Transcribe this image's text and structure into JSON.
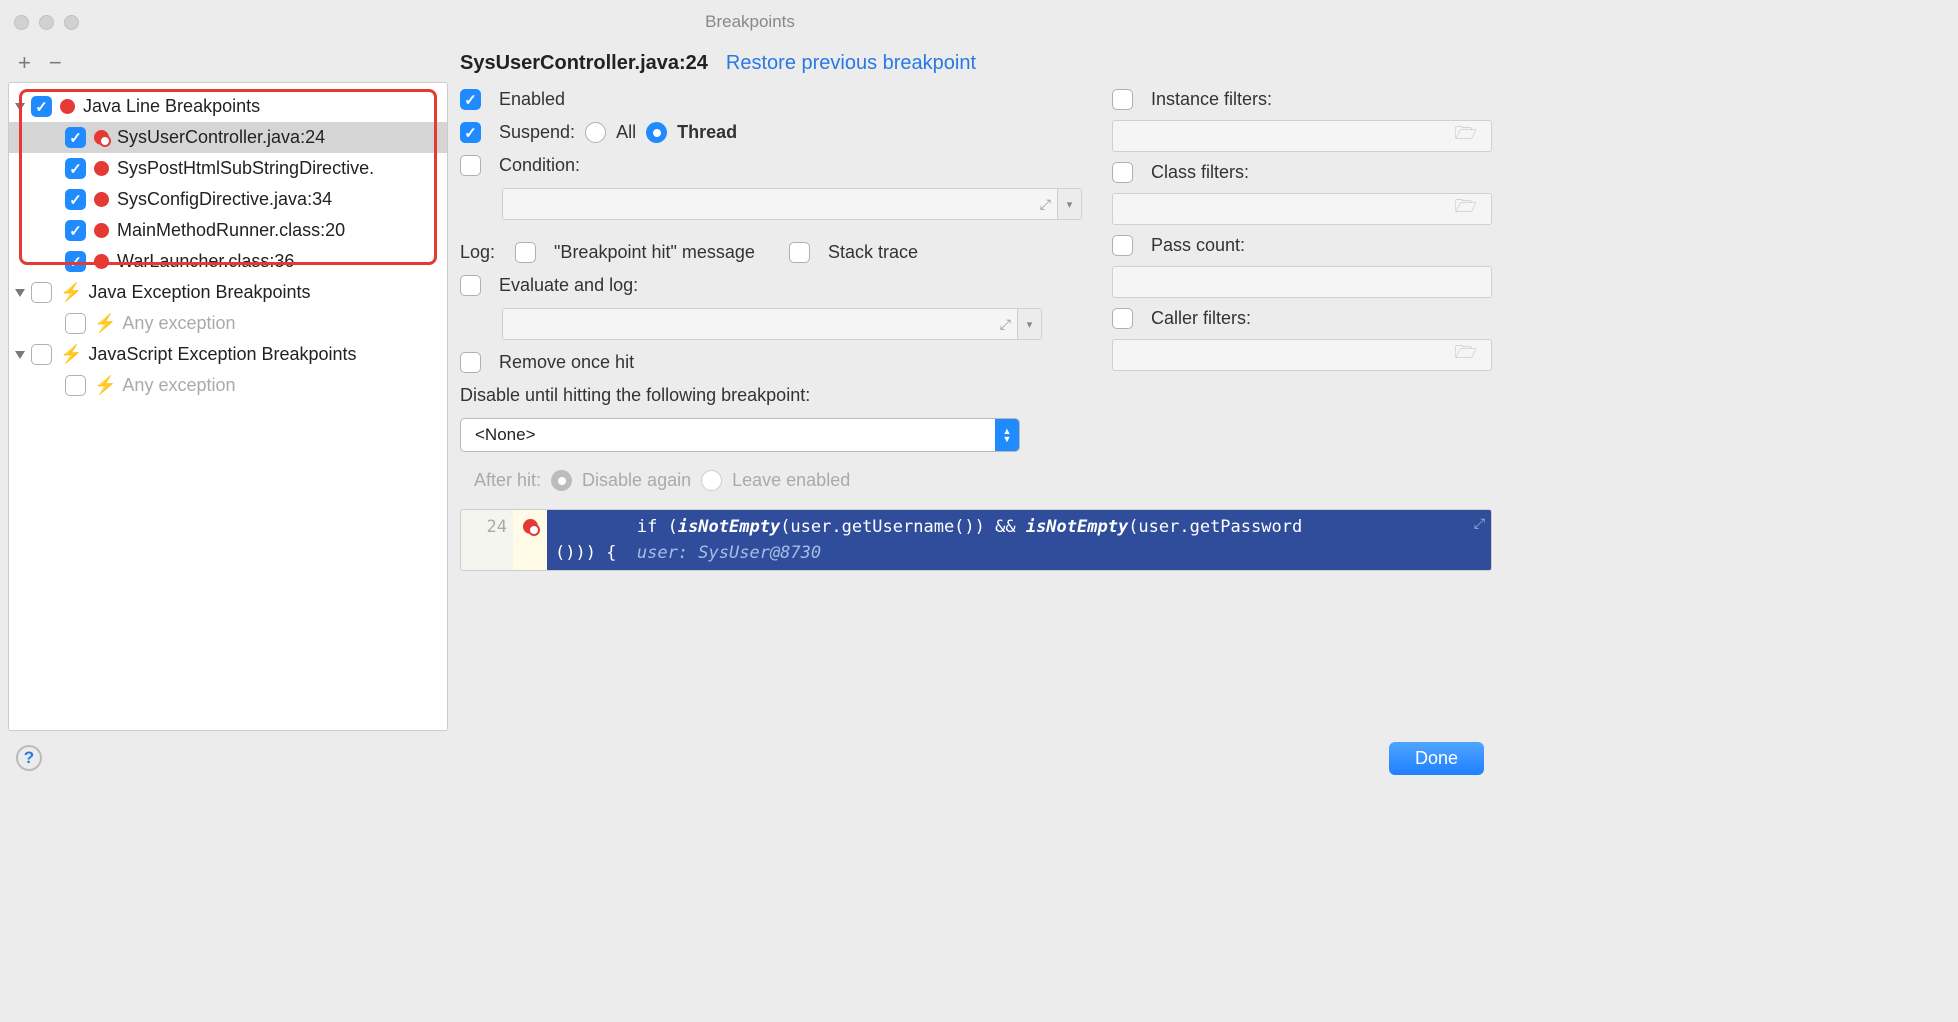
{
  "window": {
    "title": "Breakpoints"
  },
  "toolbar": {
    "add": "+",
    "remove": "−"
  },
  "tree": {
    "groups": [
      {
        "checked": true,
        "icon": "bp-dot",
        "label": "Java Line Breakpoints",
        "items": [
          {
            "checked": true,
            "label": "SysUserController.java:24",
            "selected": true,
            "muted": true
          },
          {
            "checked": true,
            "label": "SysPostHtmlSubStringDirective.",
            "muted": false
          },
          {
            "checked": true,
            "label": "SysConfigDirective.java:34",
            "muted": false
          },
          {
            "checked": true,
            "label": "MainMethodRunner.class:20",
            "muted": false
          },
          {
            "checked": true,
            "label": "WarLauncher.class:36",
            "muted": false
          }
        ]
      },
      {
        "checked": false,
        "icon": "lightning",
        "label": "Java Exception Breakpoints",
        "items": [
          {
            "checked": false,
            "label": "Any exception",
            "dim": true
          }
        ]
      },
      {
        "checked": false,
        "icon": "lightning",
        "label": "JavaScript Exception Breakpoints",
        "items": [
          {
            "checked": false,
            "label": "Any exception",
            "dim": true
          }
        ]
      }
    ]
  },
  "detail": {
    "title": "SysUserController.java:24",
    "restore": "Restore previous breakpoint",
    "enabled_label": "Enabled",
    "suspend_label": "Suspend:",
    "suspend_all": "All",
    "suspend_thread": "Thread",
    "condition_label": "Condition:",
    "log_label": "Log:",
    "log_hit": "\"Breakpoint hit\" message",
    "log_stack": "Stack trace",
    "eval_label": "Evaluate and log:",
    "remove_once_label": "Remove once hit",
    "disable_until_label": "Disable until hitting the following breakpoint:",
    "disable_until_value": "<None>",
    "after_hit_label": "After hit:",
    "after_hit_disable": "Disable again",
    "after_hit_leave": "Leave enabled",
    "instance_filters": "Instance filters:",
    "class_filters": "Class filters:",
    "pass_count": "Pass count:",
    "caller_filters": "Caller filters:"
  },
  "code": {
    "line_no": "24",
    "line1_a": "        if (",
    "line1_b": "isNotEmpty",
    "line1_c": "(user.getUsername()) && ",
    "line1_d": "isNotEmpty",
    "line1_e": "(user.getPassword",
    "line2_a": "())) {  ",
    "line2_b": "user: SysUser@8730"
  },
  "footer": {
    "done": "Done"
  }
}
